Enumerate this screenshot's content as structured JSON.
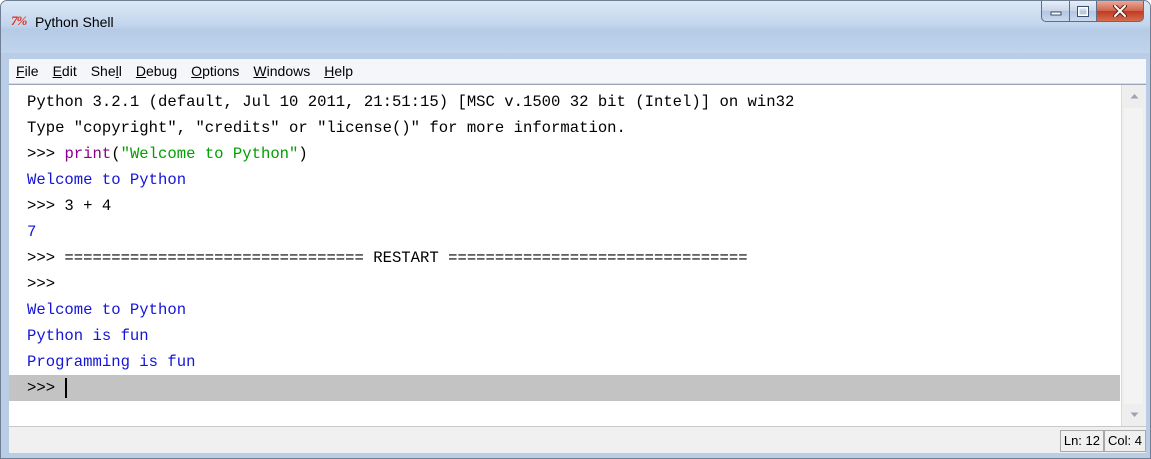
{
  "window": {
    "title": "Python Shell",
    "app_icon_text": "7%"
  },
  "menu": [
    {
      "label": "File",
      "key": "F",
      "rest": "ile"
    },
    {
      "label": "Edit",
      "key": "E",
      "rest": "dit"
    },
    {
      "label": "Shell",
      "pre": "She",
      "key": "l",
      "rest": "l"
    },
    {
      "label": "Debug",
      "key": "D",
      "rest": "ebug"
    },
    {
      "label": "Options",
      "key": "O",
      "rest": "ptions"
    },
    {
      "label": "Windows",
      "key": "W",
      "rest": "indows"
    },
    {
      "label": "Help",
      "key": "H",
      "rest": "elp"
    }
  ],
  "shell": {
    "lines": [
      {
        "type": "plain",
        "text": "Python 3.2.1 (default, Jul 10 2011, 21:51:15) [MSC v.1500 32 bit (Intel)] on win32"
      },
      {
        "type": "plain",
        "text": "Type \"copyright\", \"credits\" or \"license()\" for more information."
      },
      {
        "type": "call",
        "prompt": ">>> ",
        "func": "print",
        "open": "(",
        "arg": "\"Welcome to Python\"",
        "close": ")"
      },
      {
        "type": "output",
        "text": "Welcome to Python"
      },
      {
        "type": "plain",
        "text": ">>> 3 + 4"
      },
      {
        "type": "output",
        "text": "7"
      },
      {
        "type": "plain",
        "text": ">>> ================================ RESTART ================================"
      },
      {
        "type": "plain",
        "text": ">>> "
      },
      {
        "type": "output",
        "text": "Welcome to Python"
      },
      {
        "type": "output",
        "text": "Python is fun"
      },
      {
        "type": "output",
        "text": "Programming is fun"
      },
      {
        "type": "current",
        "text": ">>> "
      }
    ]
  },
  "status": {
    "line": "Ln: 12",
    "column": "Col: 4"
  },
  "colors": {
    "output": "#1414d8",
    "keyword": "#8b008b",
    "string": "#00a000",
    "current_line": "#c3c3c3"
  }
}
